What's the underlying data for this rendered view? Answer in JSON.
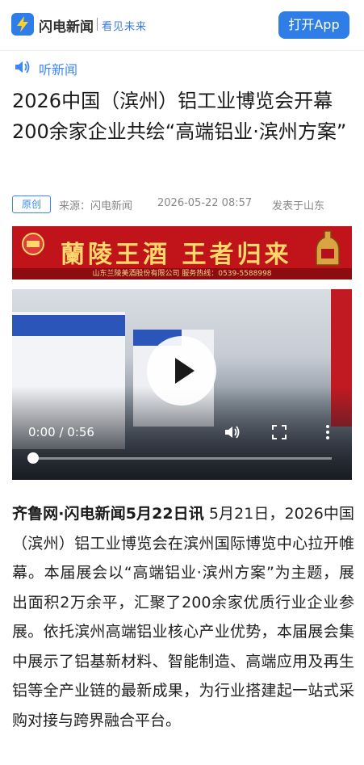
{
  "header": {
    "app_name": "闪电新闻",
    "slogan": "看见未来",
    "open_app_label": "打开App"
  },
  "listen": {
    "label": "听新闻",
    "icon": "speaker-icon"
  },
  "article": {
    "title": "2026中国（滨州）铝工业博览会开幕 200余家企业共绘“高端铝业·滨州方案”",
    "badge": "原创",
    "source": "来源：闪电新闻",
    "date": "2026-05-22 08:57",
    "location": "发表于山东",
    "lead": "齐鲁网·闪电新闻5月22日讯",
    "body": " 5月21日，2026中国（滨州）铝工业博览会在滨州国际博览中心拉开帷幕。本届展会以“高端铝业·滨州方案”为主题，展出面积2万余平，汇聚了200余家优质行业企业参展。依托滨州高端铝业核心产业优势，本届展会集中展示了铝基新材料、智能制造、高端应用及再生铝等全产业链的最新成果，为行业搭建起一站式采购对接与跨界融合平台。"
  },
  "ad": {
    "brand_text": "蘭陵王酒  王者归来",
    "footer_text": "山东兰陵美酒股份有限公司    服务热线：0539-5588998"
  },
  "video": {
    "time_display": "0:00 / 0:56",
    "progress": 0.0,
    "icons": [
      "play-icon",
      "volume-icon",
      "fullscreen-icon",
      "more-icon"
    ]
  },
  "colors": {
    "accent": "#2f7ee8",
    "link": "#3a86ff",
    "ad_red": "#c0141a"
  }
}
